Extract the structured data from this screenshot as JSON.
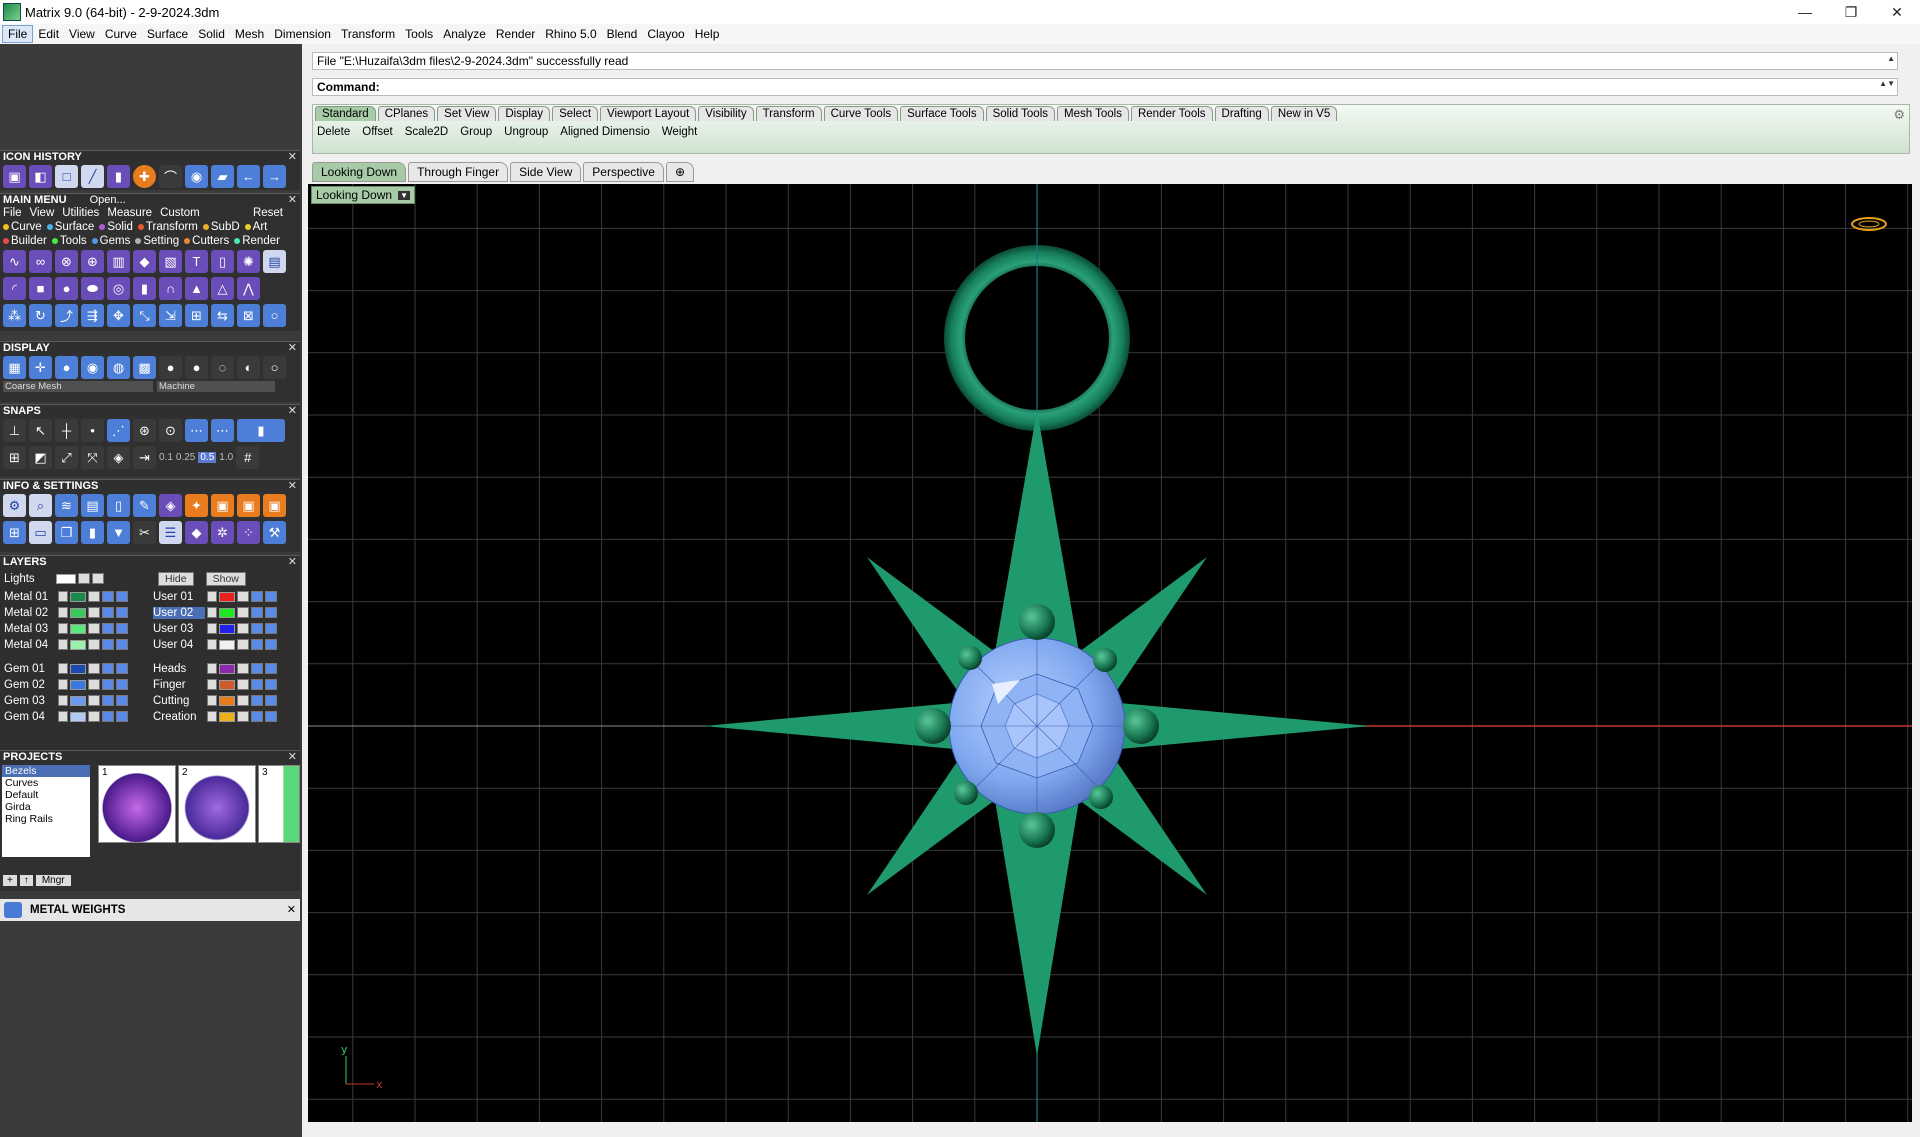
{
  "window": {
    "title": "Matrix 9.0 (64-bit) - 2-9-2024.3dm",
    "controls": [
      "—",
      "❐",
      "✕"
    ]
  },
  "menubar": [
    "File",
    "Edit",
    "View",
    "Curve",
    "Surface",
    "Solid",
    "Mesh",
    "Dimension",
    "Transform",
    "Tools",
    "Analyze",
    "Render",
    "Rhino 5.0",
    "Blend",
    "Clayoo",
    "Help"
  ],
  "command": {
    "history": "File \"E:\\Huzaifa\\3dm files\\2-9-2024.3dm\" successfully read",
    "prompt": "Command:"
  },
  "toolbar": {
    "tabs": [
      "Standard",
      "CPlanes",
      "Set View",
      "Display",
      "Select",
      "Viewport Layout",
      "Visibility",
      "Transform",
      "Curve Tools",
      "Surface Tools",
      "Solid Tools",
      "Mesh Tools",
      "Render Tools",
      "Drafting",
      "New in V5"
    ],
    "active_tab": "Standard",
    "commands": [
      "Delete",
      "Offset",
      "Scale2D",
      "Group",
      "Ungroup",
      "Aligned Dimensio",
      "Weight"
    ]
  },
  "viewport_tabs": [
    "Looking Down",
    "Through Finger",
    "Side View",
    "Perspective",
    "⊕"
  ],
  "viewport": {
    "label": "Looking Down",
    "axis_x": "x",
    "axis_y": "y",
    "colors": {
      "background": "#000000",
      "grid": "#3a3a3a",
      "metal": "#1f9a6c",
      "gem": "#7fa8f0",
      "x_axis": "#c0392b",
      "y_axis": "#1a7a7a"
    }
  },
  "left_panel": {
    "icon_history": {
      "title": "ICON HISTORY"
    },
    "main_menu": {
      "title": "MAIN MENU",
      "open": "Open...",
      "row1": [
        "File",
        "View",
        "Utilities",
        "Measure",
        "Custom"
      ],
      "reset": "Reset",
      "row2": [
        {
          "label": "Curve",
          "color": "#f0c419"
        },
        {
          "label": "Surface",
          "color": "#4ab3e8"
        },
        {
          "label": "Solid",
          "color": "#b05ad8"
        },
        {
          "label": "Transform",
          "color": "#e85a2e"
        },
        {
          "label": "SubD",
          "color": "#e8b02e"
        },
        {
          "label": "Art",
          "color": "#e8d02e"
        }
      ],
      "row3": [
        {
          "label": "Builder",
          "color": "#e84a4a"
        },
        {
          "label": "Tools",
          "color": "#4ae84a"
        },
        {
          "label": "Gems",
          "color": "#4a9ae8"
        },
        {
          "label": "Setting",
          "color": "#b0b0b0"
        },
        {
          "label": "Cutters",
          "color": "#e8882e"
        },
        {
          "label": "Render",
          "color": "#4ae8b0"
        }
      ]
    },
    "display": {
      "title": "DISPLAY",
      "mesh": "Coarse Mesh",
      "mode": "Machine"
    },
    "snaps": {
      "title": "SNAPS",
      "values": [
        "0.1",
        "0.25",
        "0.5",
        "1.0"
      ]
    },
    "info": {
      "title": "INFO & SETTINGS"
    },
    "layers": {
      "title": "LAYERS",
      "lights": "Lights",
      "hide": "Hide",
      "show": "Show",
      "left": [
        {
          "name": "Metal 01",
          "color": "#1a8a4a"
        },
        {
          "name": "Metal 02",
          "color": "#3ac85a"
        },
        {
          "name": "Metal 03",
          "color": "#5ae87a"
        },
        {
          "name": "Metal 04",
          "color": "#9af0aa"
        },
        {
          "name": "Gem 01",
          "color": "#1a4ab0"
        },
        {
          "name": "Gem 02",
          "color": "#3a7ae0"
        },
        {
          "name": "Gem 03",
          "color": "#6a9af0"
        },
        {
          "name": "Gem 04",
          "color": "#b0ccf5"
        }
      ],
      "right": [
        {
          "name": "User 01",
          "color": "#e82020"
        },
        {
          "name": "User 02",
          "color": "#20e820"
        },
        {
          "name": "User 03",
          "color": "#2020e8"
        },
        {
          "name": "User 04",
          "color": "#f0f0f0"
        },
        {
          "name": "Heads",
          "color": "#8a2ab0"
        },
        {
          "name": "Finger",
          "color": "#d05a2a"
        },
        {
          "name": "Cutting",
          "color": "#e87a1a"
        },
        {
          "name": "Creation",
          "color": "#f0b01a"
        }
      ]
    },
    "projects": {
      "title": "PROJECTS",
      "items": [
        "Bezels",
        "Curves",
        "Default",
        "Girda",
        "Ring Rails"
      ],
      "selected": "Bezels",
      "thumbs": [
        "1",
        "2",
        "3"
      ],
      "mngr": "Mngr"
    },
    "metal_weights": {
      "title": "METAL WEIGHTS"
    }
  }
}
